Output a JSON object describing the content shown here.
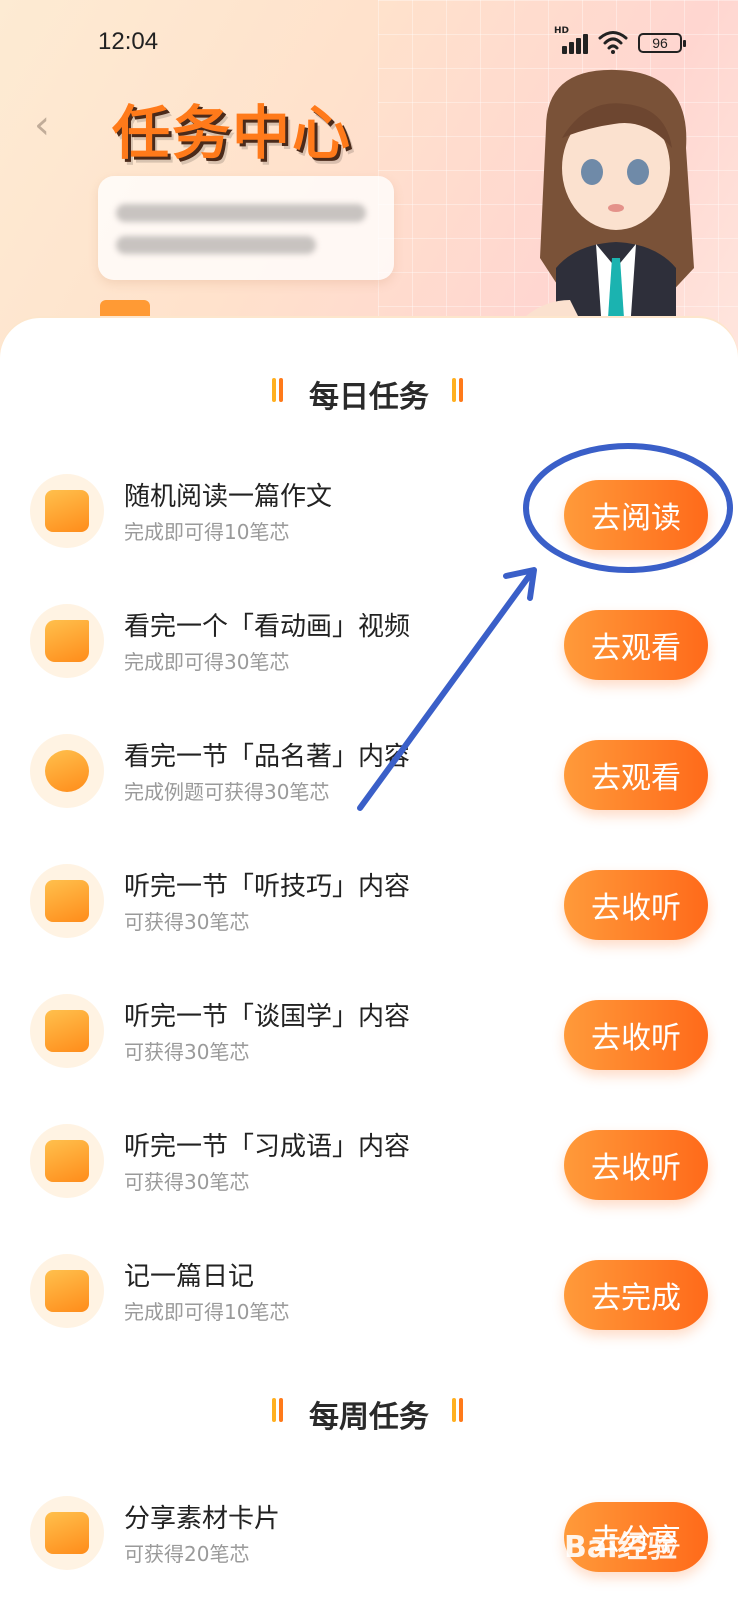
{
  "status_bar": {
    "time": "12:04",
    "network_label": "HD",
    "battery": "96"
  },
  "header": {
    "title": "任务中心"
  },
  "daily_section": {
    "title": "每日任务",
    "tasks": [
      {
        "name": "随机阅读一篇作文",
        "reward": "完成即可得10笔芯",
        "button": "去阅读",
        "icon": "calendar-icon"
      },
      {
        "name": "看完一个「看动画」视频",
        "reward": "完成即可得30笔芯",
        "button": "去观看",
        "icon": "video-icon"
      },
      {
        "name": "看完一节「品名著」内容",
        "reward": "完成例题可获得30笔芯",
        "button": "去观看",
        "icon": "book-disc-icon"
      },
      {
        "name": "听完一节「听技巧」内容",
        "reward": "可获得30笔芯",
        "button": "去收听",
        "icon": "audio-icon"
      },
      {
        "name": "听完一节「谈国学」内容",
        "reward": "可获得30笔芯",
        "button": "去收听",
        "icon": "audio-icon"
      },
      {
        "name": "听完一节「习成语」内容",
        "reward": "可获得30笔芯",
        "button": "去收听",
        "icon": "audio-icon"
      },
      {
        "name": "记一篇日记",
        "reward": "完成即可得10笔芯",
        "button": "去完成",
        "icon": "calendar-icon"
      }
    ]
  },
  "weekly_section": {
    "title": "每周任务",
    "tasks": [
      {
        "name": "分享素材卡片",
        "reward": "可获得20笔芯",
        "button": "去分享",
        "icon": "image-icon"
      }
    ]
  },
  "watermark": {
    "text": "Bai经验"
  },
  "colors": {
    "accent": "#ff7a1a",
    "button_start": "#ff9a3a",
    "button_end": "#ff6a1a",
    "annotation": "#3a5fc8"
  }
}
